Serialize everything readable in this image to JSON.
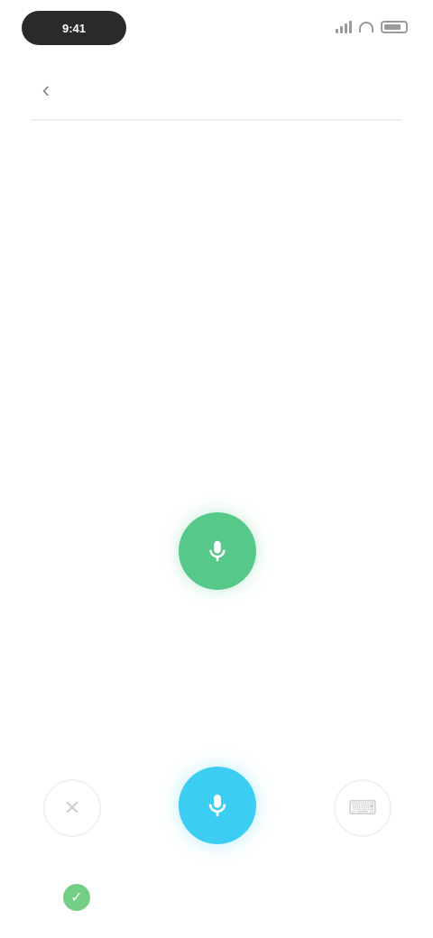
{
  "status_bar": {
    "time": "9:41",
    "icons": [
      "signal-icon",
      "wifi-icon",
      "battery-icon"
    ]
  },
  "header": {
    "back_icon": "back-arrow-icon",
    "title": ""
  },
  "intro": {
    "heading": "",
    "subheading": "",
    "hint": ""
  },
  "status": {
    "icon": "microphone-icon",
    "color": "#56c98a",
    "label": "",
    "description": ""
  },
  "controls": {
    "left": {
      "icon": "close-icon",
      "label": ""
    },
    "center": {
      "icon": "microphone-icon",
      "label": "",
      "color": "#3bcdf2"
    },
    "right": {
      "icon": "keyboard-icon",
      "label": ""
    }
  },
  "notice": {
    "icon": "check-icon",
    "color": "#74cf86",
    "text": ""
  }
}
